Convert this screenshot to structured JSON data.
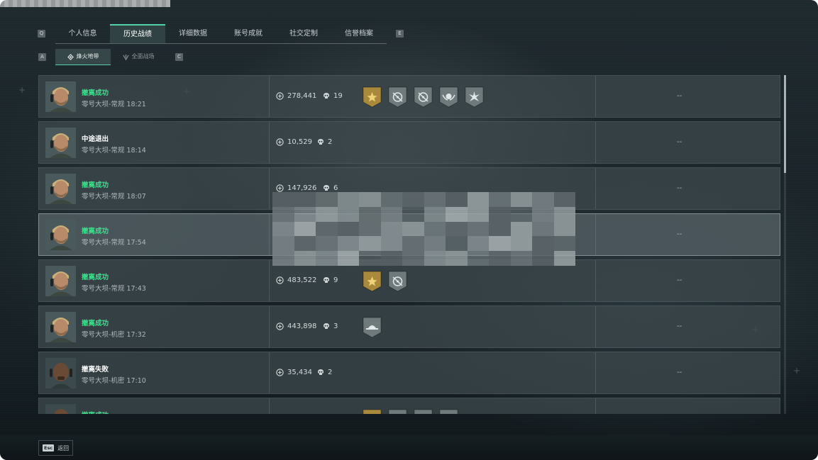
{
  "nav": {
    "key_left": "Q",
    "key_right": "E",
    "tabs": [
      {
        "label": "个人信息",
        "active": false
      },
      {
        "label": "历史战绩",
        "active": true
      },
      {
        "label": "详细数据",
        "active": false
      },
      {
        "label": "账号成就",
        "active": false
      },
      {
        "label": "社交定制",
        "active": false
      },
      {
        "label": "信誉档案",
        "active": false
      }
    ]
  },
  "subnav": {
    "key_left": "A",
    "key_right": "C",
    "tabs": [
      {
        "label": "烽火地带",
        "active": true
      },
      {
        "label": "全面战场",
        "active": false
      }
    ]
  },
  "records": [
    {
      "status": "撤离成功",
      "status_type": "success",
      "map": "零号大坝-常规 18:21",
      "value": "278,441",
      "kills": "19",
      "badges": [
        "gold-star-badge",
        "crosshair-badge",
        "crosshair-badge",
        "skull-wings-badge",
        "starburst-badge"
      ],
      "extra": "--"
    },
    {
      "status": "中途退出",
      "status_type": "quit",
      "map": "零号大坝-常规 18:14",
      "value": "10,529",
      "kills": "2",
      "badges": [],
      "extra": "--"
    },
    {
      "status": "撤离成功",
      "status_type": "success",
      "map": "零号大坝-常规 18:07",
      "value": "147,926",
      "kills": "6",
      "badges": [],
      "extra": "--"
    },
    {
      "status": "撤离成功",
      "status_type": "success",
      "map": "零号大坝-常规 17:54",
      "value": "",
      "kills": "",
      "badges": [],
      "extra": "--"
    },
    {
      "status": "撤离成功",
      "status_type": "success",
      "map": "零号大坝-常规 17:43",
      "value": "483,522",
      "kills": "9",
      "badges": [
        "gold-star-badge",
        "crosshair-badge"
      ],
      "extra": "--"
    },
    {
      "status": "撤离成功",
      "status_type": "success",
      "map": "零号大坝-机密 17:32",
      "value": "443,898",
      "kills": "3",
      "badges": [
        "hat-badge"
      ],
      "extra": "--"
    },
    {
      "status": "撤离失败",
      "status_type": "fail",
      "map": "零号大坝-机密 17:10",
      "value": "35,434",
      "kills": "2",
      "badges": [],
      "extra": "--"
    },
    {
      "status": "撤离成功",
      "status_type": "success",
      "map": "",
      "value": "",
      "kills": "",
      "badges": [
        "gold-star-badge",
        "crosshair-badge",
        "crosshair-badge",
        "skull-wings-badge"
      ],
      "extra": ""
    }
  ],
  "footer": {
    "esc_key": "Esc",
    "back_label": "返回"
  },
  "colors": {
    "accent": "#4fd1a5",
    "success": "#3fe08e",
    "gold_badge": "#a98a3c",
    "silver_badge": "#6f7a7d"
  }
}
